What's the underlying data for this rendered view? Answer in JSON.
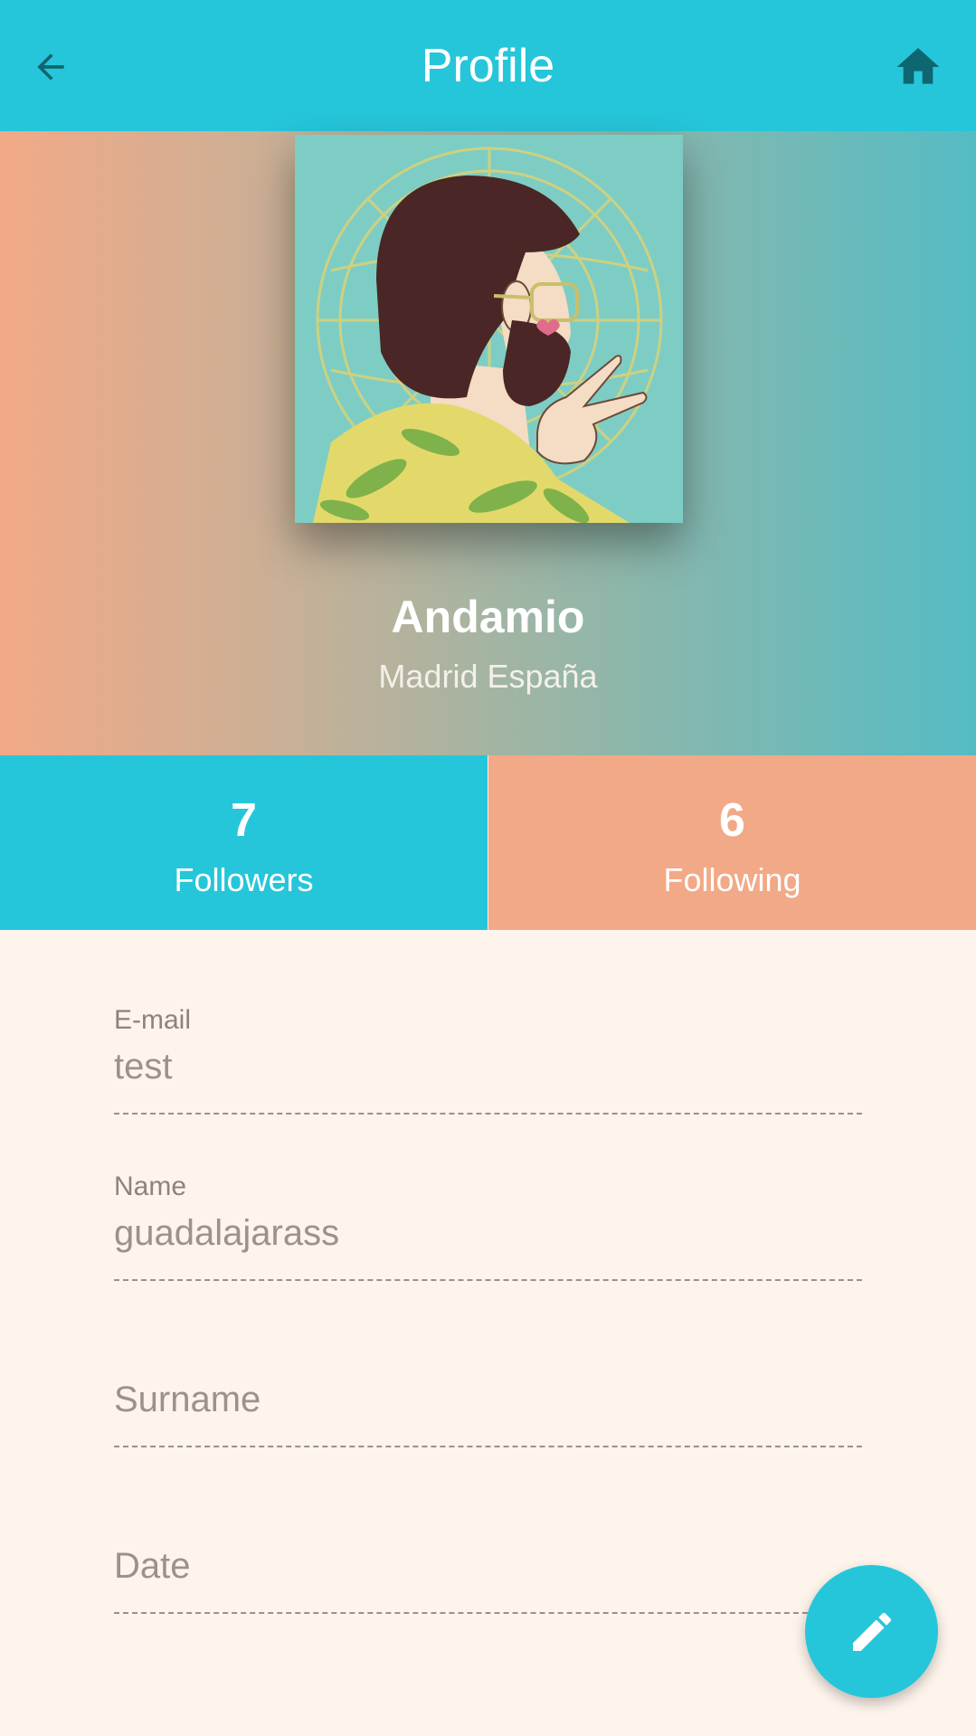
{
  "app_bar": {
    "title": "Profile",
    "back_icon": "arrow-back-icon",
    "home_icon": "home-icon"
  },
  "profile": {
    "name": "Andamio",
    "location": "Madrid España",
    "avatar": "illustrated-portrait-bearded-man-peace-sign"
  },
  "stats": {
    "followers": {
      "count": "7",
      "label": "Followers"
    },
    "following": {
      "count": "6",
      "label": "Following"
    }
  },
  "form": {
    "email": {
      "label": "E-mail",
      "value": "test"
    },
    "name": {
      "label": "Name",
      "value": "guadalajarass"
    },
    "surname": {
      "placeholder": "Surname"
    },
    "date": {
      "placeholder": "Date"
    }
  },
  "fab": {
    "icon": "edit-pencil-icon"
  },
  "colors": {
    "primary": "#26c6da",
    "accent": "#f2a987",
    "background": "#fdf4ec",
    "home_icon": "#0e6670"
  }
}
